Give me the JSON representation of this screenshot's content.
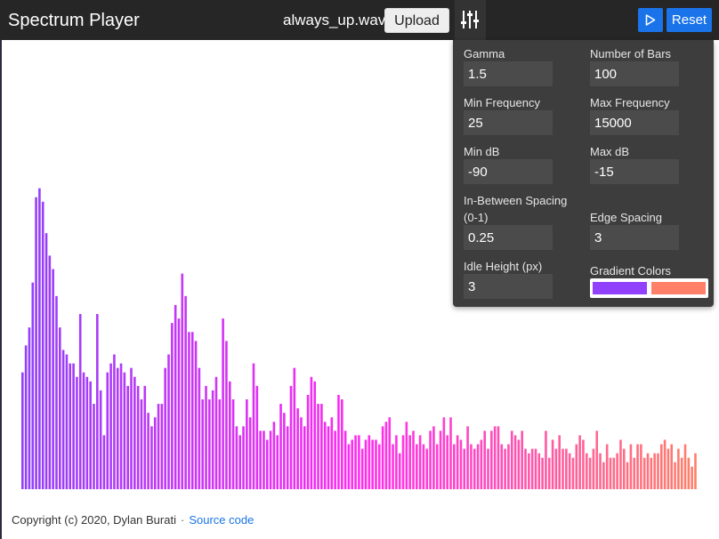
{
  "header": {
    "title": "Spectrum Player",
    "filename": "always_up.wav",
    "upload_label": "Upload",
    "reset_label": "Reset",
    "settings_icon": "sliders-icon",
    "play_icon": "play-icon"
  },
  "settings": {
    "gamma": {
      "label": "Gamma",
      "value": "1.5"
    },
    "num_bars": {
      "label": "Number of Bars",
      "value": "100"
    },
    "min_freq": {
      "label": "Min Frequency",
      "value": "25"
    },
    "max_freq": {
      "label": "Max Frequency",
      "value": "15000"
    },
    "min_db": {
      "label": "Min dB",
      "value": "-90"
    },
    "max_db": {
      "label": "Max dB",
      "value": "-15"
    },
    "spacing": {
      "label_line1": "In-Between Spacing",
      "label_line2": "(0-1)",
      "value": "0.25"
    },
    "edge_spacing": {
      "label": "Edge Spacing",
      "value": "3"
    },
    "idle_height": {
      "label": "Idle Height (px)",
      "value": "3"
    },
    "gradient": {
      "label": "Gradient Colors",
      "color_start": "#9140fb",
      "color_end": "#ff7f68"
    }
  },
  "spectrum": {
    "bar_levels": [
      0.26,
      0.32,
      0.36,
      0.46,
      0.65,
      0.67,
      0.64,
      0.57,
      0.52,
      0.49,
      0.43,
      0.36,
      0.31,
      0.3,
      0.28,
      0.28,
      0.25,
      0.39,
      0.26,
      0.25,
      0.24,
      0.19,
      0.39,
      0.22,
      0.12,
      0.26,
      0.28,
      0.3,
      0.27,
      0.28,
      0.26,
      0.23,
      0.27,
      0.25,
      0.23,
      0.2,
      0.23,
      0.17,
      0.14,
      0.16,
      0.19,
      0.19,
      0.27,
      0.3,
      0.37,
      0.41,
      0.38,
      0.48,
      0.43,
      0.35,
      0.35,
      0.33,
      0.27,
      0.2,
      0.23,
      0.2,
      0.22,
      0.25,
      0.2,
      0.38,
      0.33,
      0.24,
      0.2,
      0.14,
      0.12,
      0.14,
      0.2,
      0.16,
      0.28,
      0.23,
      0.13,
      0.13,
      0.11,
      0.13,
      0.15,
      0.12,
      0.19,
      0.17,
      0.14,
      0.23,
      0.27,
      0.18,
      0.16,
      0.14,
      0.21,
      0.25,
      0.24,
      0.19,
      0.19,
      0.15,
      0.14,
      0.16,
      0.13,
      0.21,
      0.2,
      0.13,
      0.1,
      0.11,
      0.12,
      0.12,
      0.09,
      0.11,
      0.12,
      0.11,
      0.11,
      0.1,
      0.14,
      0.15,
      0.16,
      0.1,
      0.12,
      0.08,
      0.12,
      0.15,
      0.12,
      0.13,
      0.1,
      0.12,
      0.1,
      0.09,
      0.13,
      0.14,
      0.1,
      0.13,
      0.16,
      0.12,
      0.16,
      0.1,
      0.12,
      0.11,
      0.09,
      0.14,
      0.1,
      0.09,
      0.1,
      0.11,
      0.13,
      0.09,
      0.13,
      0.14,
      0.14,
      0.1,
      0.09,
      0.1,
      0.13,
      0.12,
      0.11,
      0.13,
      0.09,
      0.08,
      0.09,
      0.09,
      0.08,
      0.07,
      0.13,
      0.07,
      0.11,
      0.09,
      0.12,
      0.09,
      0.09,
      0.08,
      0.07,
      0.1,
      0.12,
      0.11,
      0.08,
      0.07,
      0.09,
      0.13,
      0.08,
      0.06,
      0.1,
      0.07,
      0.07,
      0.08,
      0.11,
      0.09,
      0.06,
      0.1,
      0.07,
      0.1,
      0.1,
      0.07,
      0.08,
      0.07,
      0.08,
      0.08,
      0.1,
      0.11,
      0.09,
      0.1,
      0.06,
      0.09,
      0.07,
      0.1,
      0.07,
      0.05,
      0.08
    ]
  },
  "footer": {
    "copyright": "Copyright (c) 2020, Dylan Burati",
    "separator": "·",
    "source_link": "Source code"
  }
}
